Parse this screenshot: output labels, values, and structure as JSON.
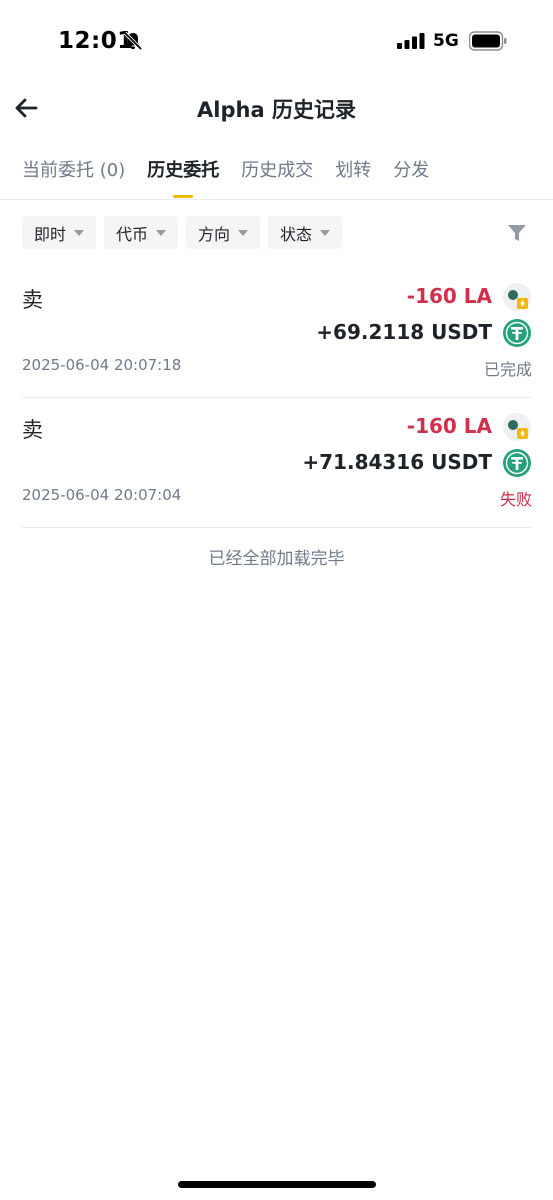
{
  "status_bar": {
    "time": "12:01",
    "network": "5G",
    "icons": [
      "bell-off-icon",
      "signal-icon",
      "battery-icon"
    ]
  },
  "header": {
    "back_icon": "arrow-left-icon",
    "title": "Alpha 历史记录"
  },
  "tabs": [
    {
      "label": "当前委托 (0)",
      "active": false
    },
    {
      "label": "历史委托",
      "active": true
    },
    {
      "label": "历史成交",
      "active": false
    },
    {
      "label": "划转",
      "active": false
    },
    {
      "label": "分发",
      "active": false
    }
  ],
  "filters": {
    "chips": [
      "即时",
      "代币",
      "方向",
      "状态"
    ],
    "filter_icon": "funnel-icon"
  },
  "records": [
    {
      "side": "卖",
      "amount": "-160 LA",
      "received": "+69.2118 USDT",
      "time": "2025-06-04 20:07:18",
      "status": "已完成",
      "status_type": "ok"
    },
    {
      "side": "卖",
      "amount": "-160 LA",
      "received": "+71.84316 USDT",
      "time": "2025-06-04 20:07:04",
      "status": "失败",
      "status_type": "fail"
    }
  ],
  "end_note": "已经全部加载完毕",
  "colors": {
    "accent": "#f0b90b",
    "sell_red": "#cf304a",
    "text_primary": "#1e2329",
    "text_secondary": "#707a8a",
    "usdt_green": "#26a17b"
  }
}
